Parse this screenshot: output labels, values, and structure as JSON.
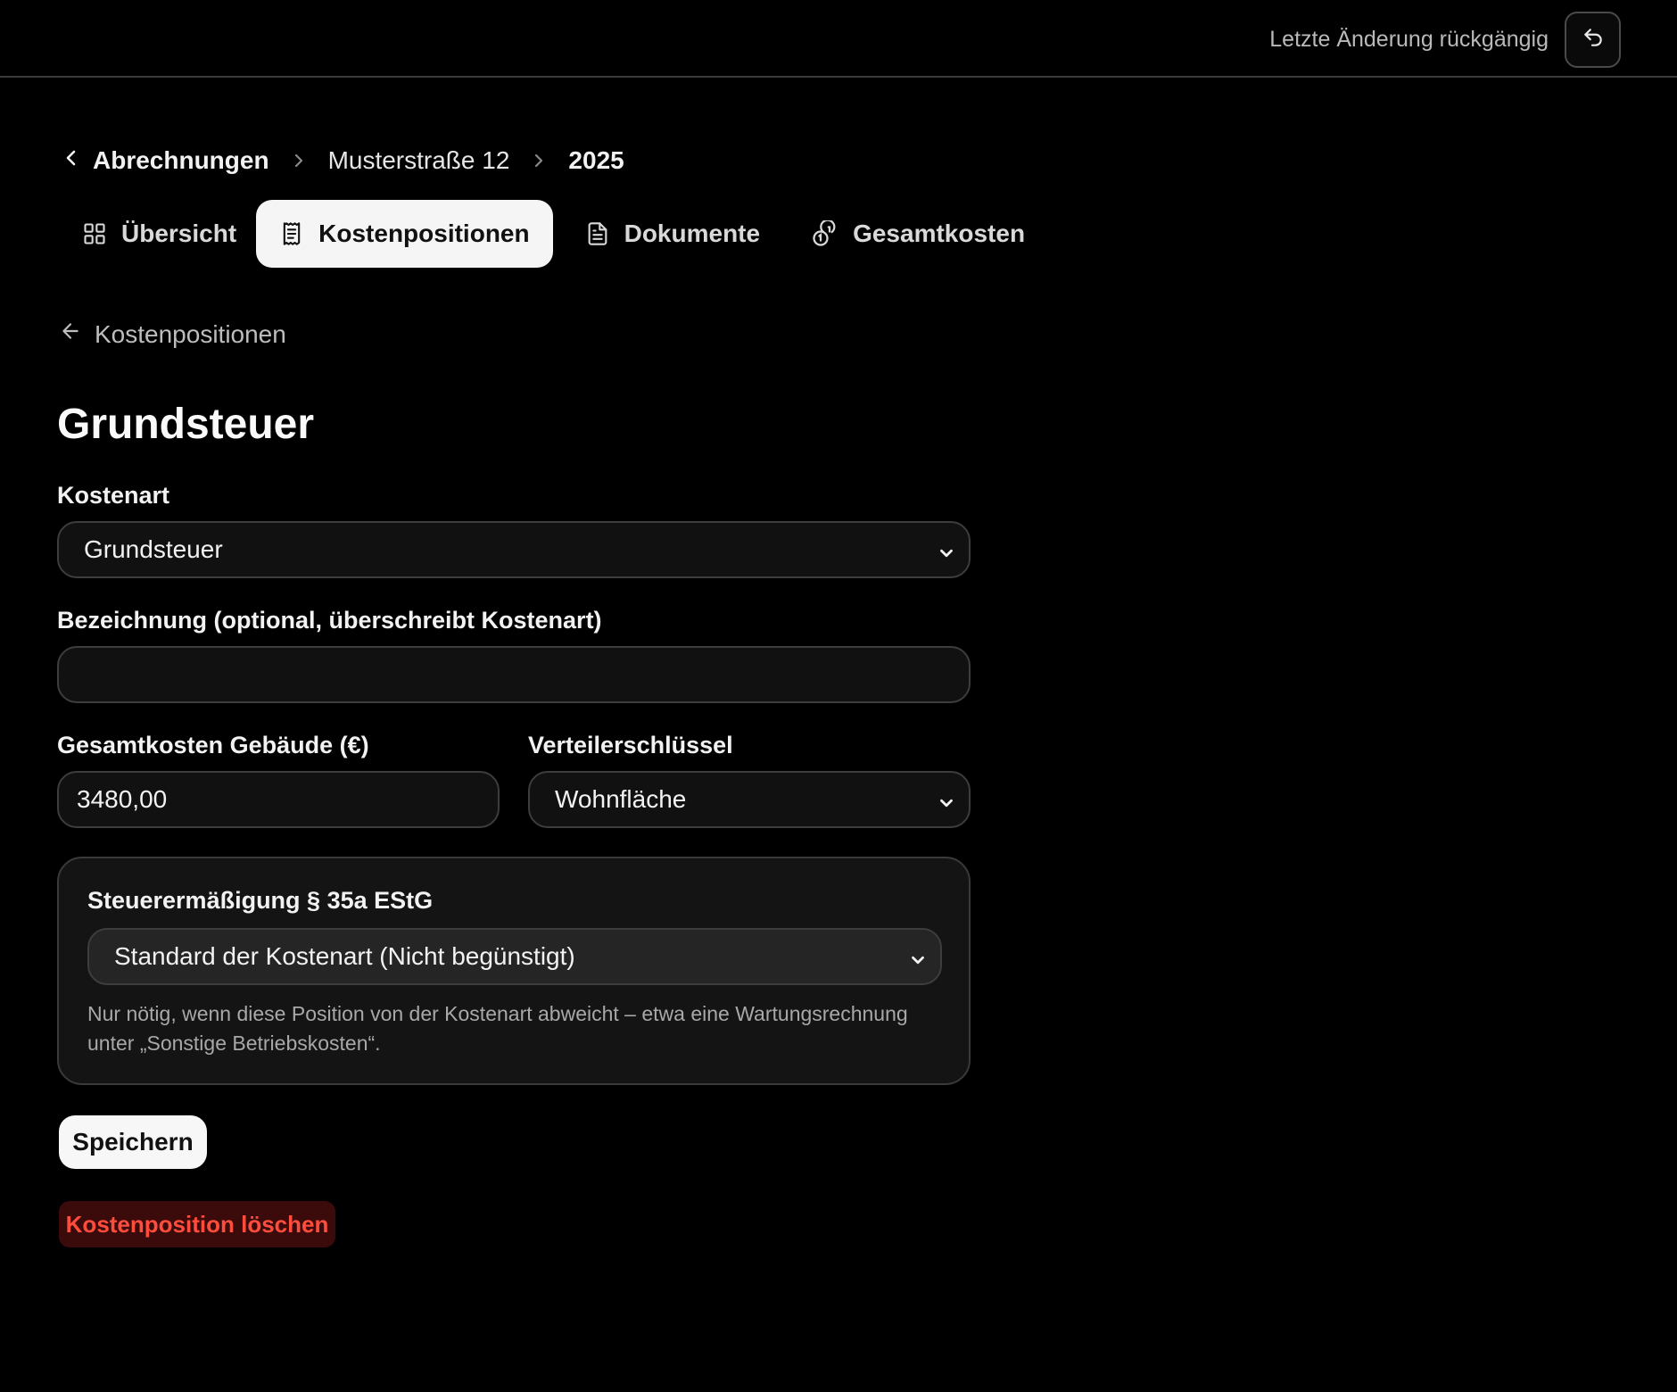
{
  "header": {
    "undo_label": "Letzte Änderung rückgängig",
    "undo_icon": "undo-arrow-icon"
  },
  "breadcrumb": {
    "back_label": "Abrechnungen",
    "property": "Musterstraße 12",
    "year": "2025"
  },
  "tabs": [
    {
      "label": "Übersicht",
      "icon": "grid-icon",
      "active": false
    },
    {
      "label": "Kostenpositionen",
      "icon": "receipt-icon",
      "active": true
    },
    {
      "label": "Dokumente",
      "icon": "document-icon",
      "active": false
    },
    {
      "label": "Gesamtkosten",
      "icon": "coins-icon",
      "active": false
    }
  ],
  "back_link": {
    "label": "Kostenpositionen",
    "icon": "arrow-left-icon"
  },
  "page_title": "Grundsteuer",
  "form": {
    "cost_type": {
      "label": "Kostenart",
      "value": "Grundsteuer"
    },
    "description": {
      "label": "Bezeichnung (optional, überschreibt Kostenart)",
      "value": ""
    },
    "total_cost": {
      "label": "Gesamtkosten Gebäude (€)",
      "value": "3480,00"
    },
    "distribution_key": {
      "label": "Verteilerschlüssel",
      "value": "Wohnfläche"
    },
    "tax_reduction": {
      "label": "Steuerermäßigung § 35a EStG",
      "value": "Standard der Kostenart (Nicht begünstigt)",
      "help": "Nur nötig, wenn diese Position von der Kostenart abweicht – etwa eine Wartungsrechnung unter „Sonstige Betriebskosten“."
    }
  },
  "actions": {
    "save_label": "Speichern",
    "delete_label": "Kostenposition löschen"
  },
  "colors": {
    "background": "#000000",
    "active_tab": "#f5f5f5",
    "danger_text": "#ff4d3d",
    "danger_bg": "#3b0b0b"
  }
}
